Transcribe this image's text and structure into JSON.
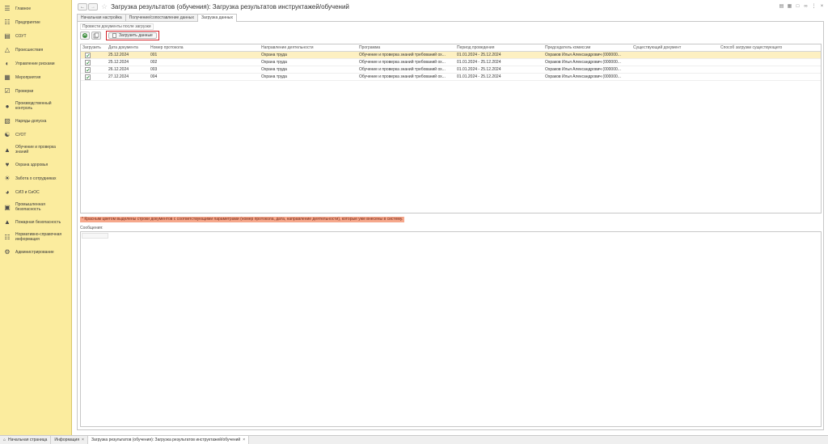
{
  "sidebar": {
    "items": [
      {
        "label": "Главное",
        "icon": "hamburger-menu-icon"
      },
      {
        "label": "Предприятие",
        "icon": "org-structure-icon"
      },
      {
        "label": "СОУТ",
        "icon": "clipboard-icon"
      },
      {
        "label": "Происшествия",
        "icon": "warning-triangle-icon"
      },
      {
        "label": "Управление рисками",
        "icon": "risk-gauge-icon"
      },
      {
        "label": "Мероприятия",
        "icon": "task-list-icon"
      },
      {
        "label": "Проверки",
        "icon": "checklist-icon"
      },
      {
        "label": "Производственный контроль",
        "icon": "inspector-icon"
      },
      {
        "label": "Наряды-допуска",
        "icon": "permit-book-icon"
      },
      {
        "label": "СУОТ",
        "icon": "handshake-icon"
      },
      {
        "label": "Обучение и проверка знаний",
        "icon": "graduation-cap-icon"
      },
      {
        "label": "Охрана здоровья",
        "icon": "heart-shield-icon"
      },
      {
        "label": "Забота о сотрудниках",
        "icon": "sun-care-icon"
      },
      {
        "label": "СИЗ и СиОС",
        "icon": "helmet-icon"
      },
      {
        "label": "Промышленная безопасность",
        "icon": "factory-icon"
      },
      {
        "label": "Пожарная безопасность",
        "icon": "fire-extinguisher-icon"
      },
      {
        "label": "Нормативно-справочная информация",
        "icon": "books-icon"
      },
      {
        "label": "Администрирование",
        "icon": "gear-icon"
      }
    ]
  },
  "window": {
    "title": "Загрузка результатов (обучения): Загрузка результатов инструктажей/обучений"
  },
  "tabs": [
    {
      "label": "Начальная настройка"
    },
    {
      "label": "Получение/сопоставление данных"
    },
    {
      "label": "Загрузка данных"
    }
  ],
  "panel": {
    "post_after_load": "Провести документы после загрузки",
    "load_button": "Загрузить данные"
  },
  "table": {
    "columns": [
      "Загрузить",
      "Дата документа",
      "Номер протокола",
      "Направление деятельности",
      "Программа",
      "Период проведения",
      "Председатель комиссии",
      "Существующий документ",
      "Способ загрузки существующего"
    ],
    "rows": [
      {
        "checked": true,
        "date": "25.12.2024",
        "number": "001",
        "direction": "Охрана труда",
        "program": "Обучение и проверка знаний требований ох...",
        "period": "01.01.2024 - 25.12.2024",
        "chairman": "Охраков Илья Александрович (000000...",
        "existing": "",
        "method": ""
      },
      {
        "checked": true,
        "date": "25.12.2024",
        "number": "002",
        "direction": "Охрана труда",
        "program": "Обучение и проверка знаний требований ох...",
        "period": "01.01.2024 - 25.12.2024",
        "chairman": "Охраков Илья Александрович (000000...",
        "existing": "",
        "method": ""
      },
      {
        "checked": true,
        "date": "26.12.2024",
        "number": "003",
        "direction": "Охрана труда",
        "program": "Обучение и проверка знаний требований ох...",
        "period": "01.01.2024 - 25.12.2024",
        "chairman": "Охраков Илья Александрович (000000...",
        "existing": "",
        "method": ""
      },
      {
        "checked": true,
        "date": "27.12.2024",
        "number": "004",
        "direction": "Охрана труда",
        "program": "Обучение и проверка знаний требований ох...",
        "period": "01.01.2024 - 25.12.2024",
        "chairman": "Охраков Илья Александрович (000000...",
        "existing": "",
        "method": ""
      }
    ]
  },
  "note": "* Красным цветом выделены строки документов с соответствующими параметрами (номер протокола, дата, направление деятельности), которые уже внесены в систему.",
  "messages_label": "Сообщения:",
  "taskbar": {
    "home": "Начальная страница",
    "tabs": [
      {
        "label": "Информация"
      },
      {
        "label": "Загрузка результатов (обучения): Загрузка результатов инструктажей/обучений"
      }
    ]
  },
  "colors": {
    "sidebar_bg": "#fbec9e",
    "selected_row": "#fdf0c2",
    "highlight_border": "#d2232a",
    "note_bg": "#f6a88c",
    "check_green": "#2e8b3a"
  }
}
